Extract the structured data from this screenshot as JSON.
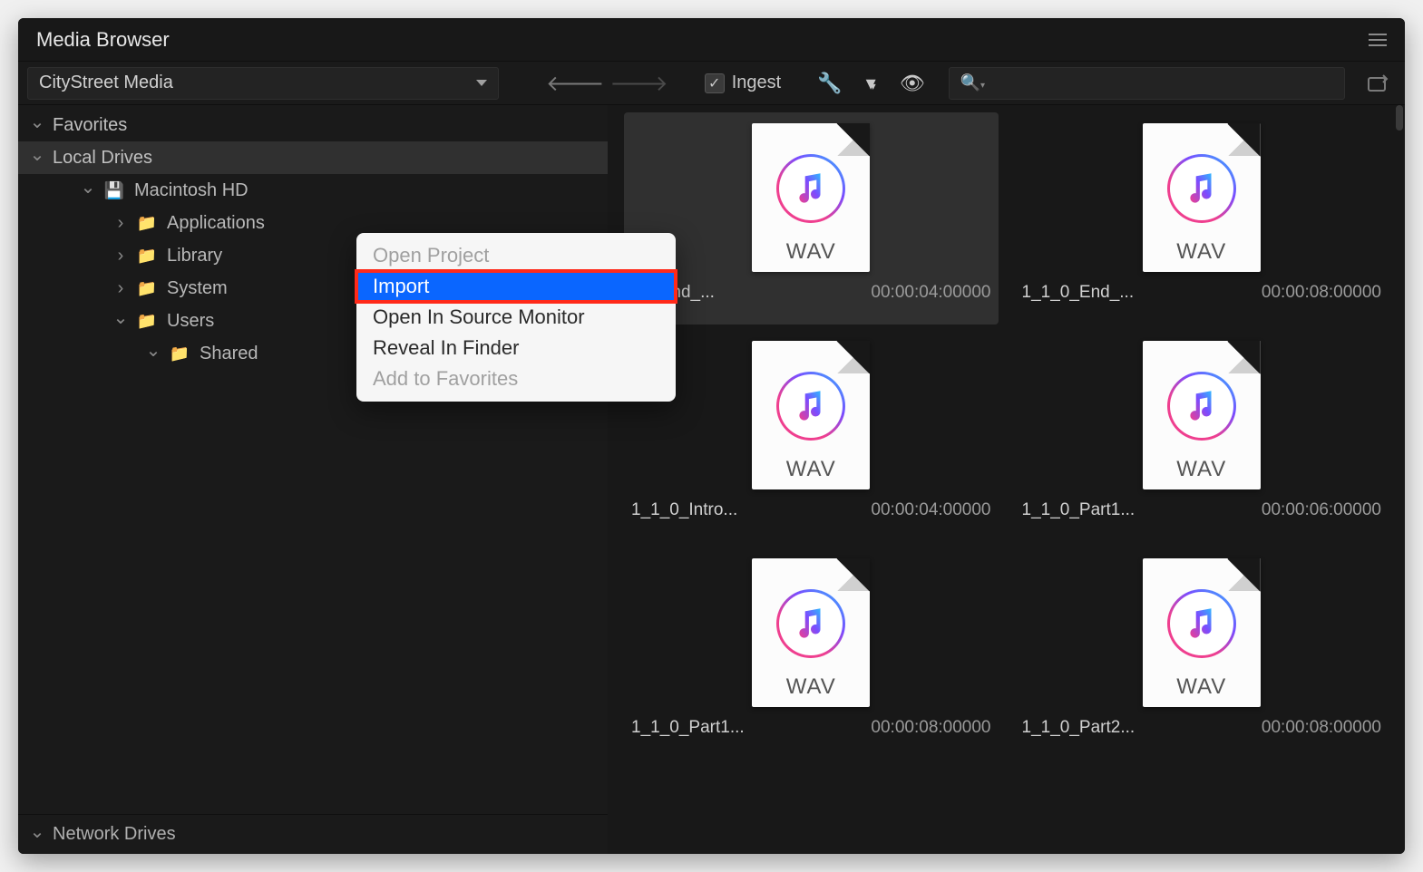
{
  "title": "Media Browser",
  "path_selected": "CityStreet Media",
  "ingest_label": "Ingest",
  "search_placeholder": "",
  "sidebar": {
    "favorites": "Favorites",
    "local_drives": "Local Drives",
    "drive": "Macintosh HD",
    "applications": "Applications",
    "library": "Library",
    "system": "System",
    "users": "Users",
    "shared": "Shared",
    "network": "Network Drives"
  },
  "context_menu": {
    "open_project": "Open Project",
    "import": "Import",
    "open_source": "Open In Source Monitor",
    "reveal": "Reveal In Finder",
    "add_fav": "Add to Favorites"
  },
  "files": [
    {
      "name": "_0_End_...",
      "name_full": "1_1_0_End_...",
      "dur": "00:00:04:00000",
      "ext": "WAV",
      "selected": true
    },
    {
      "name": "1_1_0_End_...",
      "dur": "00:00:08:00000",
      "ext": "WAV",
      "selected": false
    },
    {
      "name": "1_1_0_Intro...",
      "dur": "00:00:04:00000",
      "ext": "WAV",
      "selected": false
    },
    {
      "name": "1_1_0_Part1...",
      "dur": "00:00:06:00000",
      "ext": "WAV",
      "selected": false
    },
    {
      "name": "1_1_0_Part1...",
      "dur": "00:00:08:00000",
      "ext": "WAV",
      "selected": false
    },
    {
      "name": "1_1_0_Part2...",
      "dur": "00:00:08:00000",
      "ext": "WAV",
      "selected": false
    }
  ]
}
